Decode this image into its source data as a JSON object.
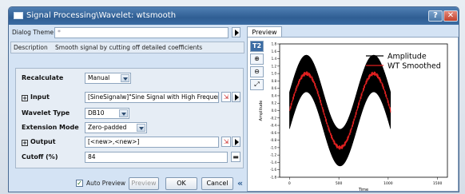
{
  "window": {
    "title": "Signal Processing\\Wavelet: wtsmooth",
    "help_label": "?",
    "close_label": "✕"
  },
  "theme": {
    "label": "Dialog Theme",
    "value": "*"
  },
  "description": {
    "label": "Description",
    "value": "Smooth signal by cutting off detailed coefficients"
  },
  "fields": {
    "recalculate": {
      "label": "Recalculate",
      "value": "Manual"
    },
    "input": {
      "label": "Input",
      "value": "[SineSignalw]\"Sine Signal with High Frequency\"!(A\""
    },
    "wavelet_type": {
      "label": "Wavelet Type",
      "value": "DB10"
    },
    "extension_mode": {
      "label": "Extension Mode",
      "value": "Zero-padded"
    },
    "output": {
      "label": "Output",
      "value": "[<new>,<new>]"
    },
    "cutoff": {
      "label": "Cutoff (%)",
      "value": "84"
    }
  },
  "buttons": {
    "auto_preview": "Auto Preview",
    "preview": "Preview",
    "ok": "OK",
    "cancel": "Cancel",
    "collapse": "«"
  },
  "preview": {
    "tab": "Preview",
    "tool_t2": "T2"
  },
  "chart_data": {
    "type": "line",
    "xlabel": "Time",
    "ylabel": "Amplitude",
    "xlim": [
      -100,
      1600
    ],
    "ylim": [
      -1.8,
      1.8
    ],
    "xticks": [
      0,
      500,
      1000,
      1500
    ],
    "yticks": [
      1.8,
      1.6,
      1.4,
      1.2,
      1.0,
      0.8,
      0.6,
      0.4,
      0.2,
      0.0,
      -0.2,
      -0.4,
      -0.6,
      -0.8,
      -1.0,
      -1.2,
      -1.4,
      -1.6,
      -1.8
    ],
    "series": [
      {
        "name": "Amplitude",
        "color": "#000000",
        "description": "sine with high-frequency noise"
      },
      {
        "name": "WT Smoothed",
        "color": "#e02020"
      }
    ],
    "legend": "top-right",
    "grid": false
  },
  "colors": {
    "accent": "#2f5e93",
    "smoothed": "#e02020",
    "noisy": "#000000"
  }
}
